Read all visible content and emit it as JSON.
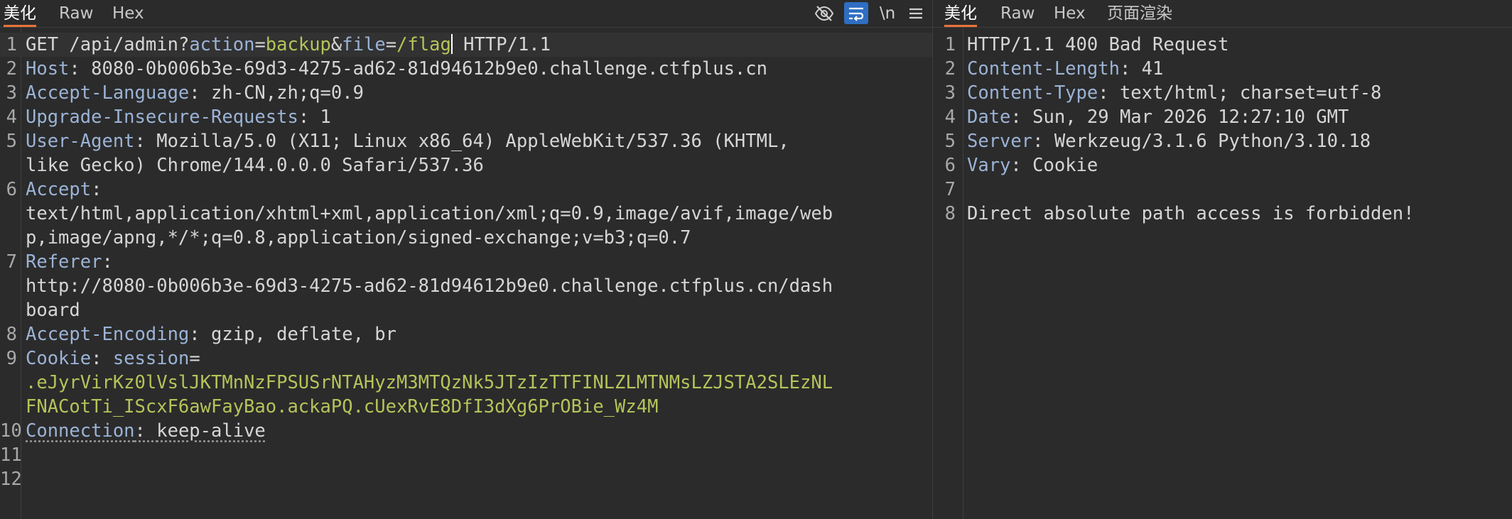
{
  "request": {
    "tabs": [
      {
        "label": "美化",
        "active": true
      },
      {
        "label": "Raw",
        "active": false
      },
      {
        "label": "Hex",
        "active": false
      }
    ],
    "tools": {
      "hide_icon": "eye-off-icon",
      "wrap_icon": "wrap-lines-icon",
      "newline_label": "\\n",
      "menu_icon": "menu-icon"
    },
    "line_numbers": [
      "1",
      "2",
      "3",
      "4",
      "5",
      "",
      "6",
      "",
      "",
      "7",
      "",
      "",
      "8",
      "9",
      "",
      "",
      "10",
      "11",
      "12"
    ],
    "l1": {
      "method": "GET ",
      "path": "/api/admin?",
      "p1": "action",
      "eq": "=",
      "v1": "backup",
      "amp": "&",
      "p2": "file",
      "eq2": "=",
      "v2": "/flag",
      "proto": " HTTP/1.1"
    },
    "l2": {
      "name": "Host",
      "sep": ": ",
      "value": "8080-0b006b3e-69d3-4275-ad62-81d94612b9e0.challenge.ctfplus.cn"
    },
    "l3": {
      "name": "Accept-Language",
      "sep": ": ",
      "value": "zh-CN,zh;q=0.9"
    },
    "l4": {
      "name": "Upgrade-Insecure-Requests",
      "sep": ": ",
      "value": "1"
    },
    "l5": {
      "name": "User-Agent",
      "sep": ": ",
      "value": "Mozilla/5.0 (X11; Linux x86_64) AppleWebKit/537.36 (KHTML,",
      "cont": "like Gecko) Chrome/144.0.0.0 Safari/537.36"
    },
    "l6": {
      "name": "Accept",
      "sep": ":",
      "cont1": "text/html,application/xhtml+xml,application/xml;q=0.9,image/avif,image/web",
      "cont2": "p,image/apng,*/*;q=0.8,application/signed-exchange;v=b3;q=0.7"
    },
    "l7": {
      "name": "Referer",
      "sep": ":",
      "cont1": "http://8080-0b006b3e-69d3-4275-ad62-81d94612b9e0.challenge.ctfplus.cn/dash",
      "cont2": "board"
    },
    "l8": {
      "name": "Accept-Encoding",
      "sep": ": ",
      "value": "gzip, deflate, br"
    },
    "l9": {
      "name": "Cookie",
      "sep": ": ",
      "cookie_name": "session",
      "eq": "=",
      "cont1": ".eJyrVirKz0lVslJKTMnNzFPSUSrNTAHyzM3MTQzNk5JTzIzTTFINLZLMTNMsLZJSTA2SLEzNL",
      "cont2": "FNACotTi_IScxF6awFayBao.ackaPQ.cUexRvE8DfI3dXg6PrOBie_Wz4M"
    },
    "l10": {
      "name": "Connection",
      "sep": ": ",
      "value": "keep-alive"
    }
  },
  "response": {
    "tabs": [
      {
        "label": "美化",
        "active": true
      },
      {
        "label": "Raw",
        "active": false
      },
      {
        "label": "Hex",
        "active": false
      },
      {
        "label": "页面渲染",
        "active": false
      }
    ],
    "line_numbers": [
      "1",
      "2",
      "3",
      "4",
      "5",
      "6",
      "7",
      "8"
    ],
    "status_line": "HTTP/1.1 400 Bad Request",
    "headers": [
      {
        "name": "Content-Length",
        "sep": ": ",
        "value": "41"
      },
      {
        "name": "Content-Type",
        "sep": ": ",
        "value": "text/html; charset=utf-8"
      },
      {
        "name": "Date",
        "sep": ": ",
        "value": "Sun, 29 Mar 2026 12:27:10 GMT"
      },
      {
        "name": "Server",
        "sep": ": ",
        "value": "Werkzeug/3.1.6 Python/3.10.18"
      },
      {
        "name": "Vary",
        "sep": ": ",
        "value": "Cookie"
      }
    ],
    "body": "Direct absolute path access is forbidden!"
  }
}
